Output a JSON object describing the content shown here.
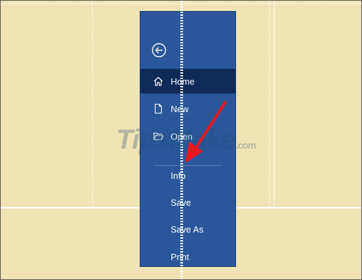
{
  "menu": {
    "items": [
      {
        "label": "Home",
        "icon": "home-icon",
        "selected": true
      },
      {
        "label": "New",
        "icon": "new-document-icon",
        "selected": false
      },
      {
        "label": "Open",
        "icon": "open-folder-icon",
        "selected": false
      },
      {
        "label": "Info",
        "selected": false
      },
      {
        "label": "Save",
        "selected": false
      },
      {
        "label": "Save As",
        "selected": false
      },
      {
        "label": "Print",
        "selected": false
      }
    ]
  },
  "watermark": {
    "brand": "TipsMake",
    "suffix": ".com"
  },
  "colors": {
    "background": "#F0E3B5",
    "menu": "#2B579A",
    "menu_selected": "#0E2A57",
    "arrow": "#E8171F",
    "guides": "#FFFFFF"
  }
}
